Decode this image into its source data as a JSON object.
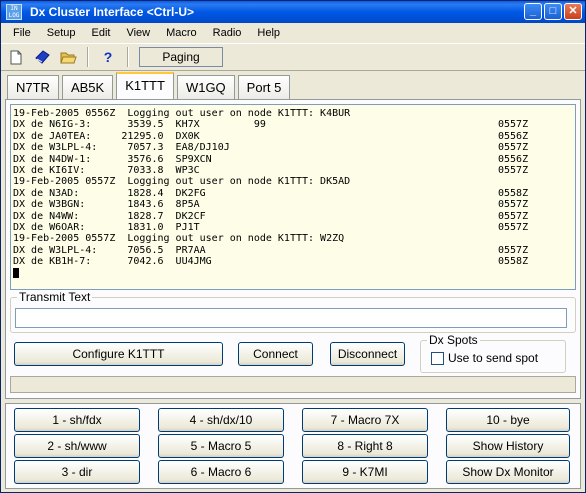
{
  "window": {
    "title": "Dx Cluster Interface   <Ctrl-U>",
    "icon_text": "IN LOG"
  },
  "menu": [
    "File",
    "Setup",
    "Edit",
    "View",
    "Macro",
    "Radio",
    "Help"
  ],
  "toolbar": {
    "paging_label": "Paging",
    "help_glyph": "?"
  },
  "tabs": [
    "N7TR",
    "AB5K",
    "K1TTT",
    "W1GQ",
    "Port 5"
  ],
  "active_tab": "K1TTT",
  "log_lines": [
    {
      "text": "19-Feb-2005 0556Z  Logging out user on node K1TTT: K4BUR",
      "time": ""
    },
    {
      "text": "DX de N6IG-3:      3539.5  KH7X         99",
      "time": "0557Z"
    },
    {
      "text": "DX de JA0TEA:     21295.0  DX0K",
      "time": "0556Z"
    },
    {
      "text": "DX de W3LPL-4:     7057.3  EA8/DJ10J",
      "time": "0557Z"
    },
    {
      "text": "DX de N4DW-1:      3576.6  SP9XCN",
      "time": "0556Z"
    },
    {
      "text": "DX de KI6IV:       7033.8  WP3C",
      "time": "0557Z"
    },
    {
      "text": "19-Feb-2005 0557Z  Logging out user on node K1TTT: DK5AD",
      "time": ""
    },
    {
      "text": "DX de N3AD:        1828.4  DK2FG",
      "time": "0558Z"
    },
    {
      "text": "DX de W3BGN:       1843.6  8P5A",
      "time": "0557Z"
    },
    {
      "text": "DX de N4WW:        1828.7  DK2CF",
      "time": "0557Z"
    },
    {
      "text": "DX de W6OAR:       1831.0  PJ1T",
      "time": "0557Z"
    },
    {
      "text": "19-Feb-2005 0557Z  Logging out user on node K1TTT: W2ZQ",
      "time": ""
    },
    {
      "text": "DX de W3LPL-4:     7056.5  PR7AA",
      "time": "0557Z"
    },
    {
      "text": "DX de KB1H-7:      7042.6  UU4JMG",
      "time": "0558Z"
    }
  ],
  "transmit": {
    "legend": "Transmit Text",
    "value": ""
  },
  "buttons": {
    "configure": "Configure K1TTT",
    "connect": "Connect",
    "disconnect": "Disconnect"
  },
  "dx_spots": {
    "legend": "Dx Spots",
    "checkbox_label": "Use to send spot"
  },
  "macros": [
    [
      "1 - sh/fdx",
      "4 - sh/dx/10",
      "7 - Macro 7X",
      "10 - bye"
    ],
    [
      "2 - sh/www",
      "5 - Macro 5",
      "8 - Right 8",
      "Show History"
    ],
    [
      "3 - dir",
      "6 - Macro 6",
      "9 - K7MI",
      "Show Dx Monitor"
    ]
  ]
}
